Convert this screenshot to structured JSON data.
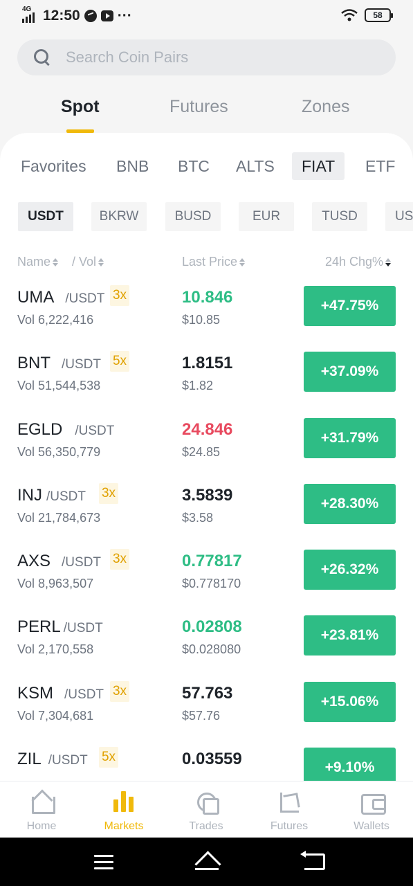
{
  "status_bar": {
    "network": "4G",
    "time": "12:50",
    "more": "···",
    "battery": "58"
  },
  "search": {
    "placeholder": "Search Coin Pairs"
  },
  "top_tabs": [
    {
      "label": "Spot",
      "active": true
    },
    {
      "label": "Futures",
      "active": false
    },
    {
      "label": "Zones",
      "active": false
    }
  ],
  "categories": [
    {
      "label": "Favorites"
    },
    {
      "label": "BNB"
    },
    {
      "label": "BTC"
    },
    {
      "label": "ALTS"
    },
    {
      "label": "FIAT",
      "active": true
    },
    {
      "label": "ETF"
    }
  ],
  "quote_tabs": [
    {
      "label": "USDT",
      "active": true
    },
    {
      "label": "BKRW"
    },
    {
      "label": "BUSD"
    },
    {
      "label": "EUR"
    },
    {
      "label": "TUSD"
    },
    {
      "label": "US"
    }
  ],
  "columns": {
    "name": "Name",
    "vol": "/ Vol",
    "last_price": "Last Price",
    "change": "24h Chg%"
  },
  "colors": {
    "up": "#2ebd85",
    "down": "#e84a5f",
    "accent": "#f0b90b"
  },
  "rows": [
    {
      "symbol": "UMA",
      "quote": "/USDT",
      "leverage": "3x",
      "volume": "Vol 6,222,416",
      "price": "10.846",
      "price_dir": "up",
      "usd": "$10.85",
      "change": "+47.75%"
    },
    {
      "symbol": "BNT",
      "quote": "/USDT",
      "leverage": "5x",
      "volume": "Vol 51,544,538",
      "price": "1.8151",
      "price_dir": "flat",
      "usd": "$1.82",
      "change": "+37.09%"
    },
    {
      "symbol": "EGLD",
      "quote": "/USDT",
      "leverage": "",
      "volume": "Vol 56,350,779",
      "price": "24.846",
      "price_dir": "down",
      "usd": "$24.85",
      "change": "+31.79%"
    },
    {
      "symbol": "INJ",
      "quote": "/USDT",
      "leverage": "3x",
      "volume": "Vol 21,784,673",
      "price": "3.5839",
      "price_dir": "flat",
      "usd": "$3.58",
      "change": "+28.30%"
    },
    {
      "symbol": "AXS",
      "quote": "/USDT",
      "leverage": "3x",
      "volume": "Vol 8,963,507",
      "price": "0.77817",
      "price_dir": "up",
      "usd": "$0.778170",
      "change": "+26.32%"
    },
    {
      "symbol": "PERL",
      "quote": "/USDT",
      "leverage": "",
      "volume": "Vol 2,170,558",
      "price": "0.02808",
      "price_dir": "up",
      "usd": "$0.028080",
      "change": "+23.81%"
    },
    {
      "symbol": "KSM",
      "quote": "/USDT",
      "leverage": "3x",
      "volume": "Vol 7,304,681",
      "price": "57.763",
      "price_dir": "flat",
      "usd": "$57.76",
      "change": "+15.06%"
    },
    {
      "symbol": "ZIL",
      "quote": "/USDT",
      "leverage": "5x",
      "volume": "",
      "price": "0.03559",
      "price_dir": "flat",
      "usd": "",
      "change": "+9.10%"
    }
  ],
  "bottom_nav": [
    {
      "label": "Home",
      "icon": "home-icon"
    },
    {
      "label": "Markets",
      "icon": "markets-icon",
      "active": true
    },
    {
      "label": "Trades",
      "icon": "trades-icon"
    },
    {
      "label": "Futures",
      "icon": "futures-icon"
    },
    {
      "label": "Wallets",
      "icon": "wallet-icon"
    }
  ]
}
